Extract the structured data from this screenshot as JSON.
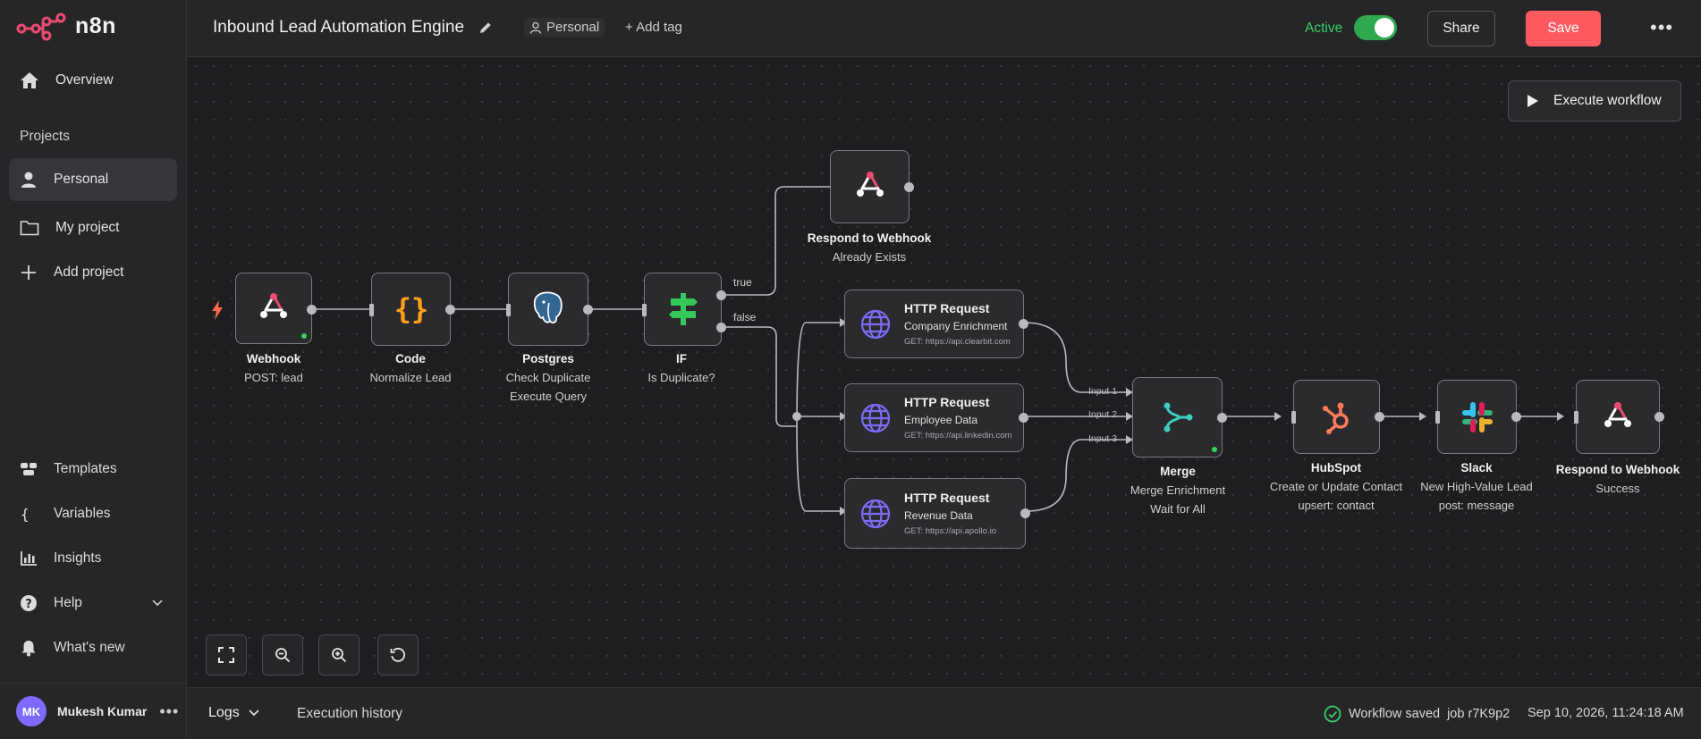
{
  "app": {
    "name": "n8n"
  },
  "sidebar": {
    "overview": "Overview",
    "projects_heading": "Projects",
    "projects": [
      {
        "label": "Personal",
        "icon": "user-icon",
        "active": true
      },
      {
        "label": "My project",
        "icon": "folder-icon",
        "active": false
      },
      {
        "label": "Add project",
        "icon": "plus-icon",
        "active": false
      }
    ],
    "bottom": [
      {
        "label": "Templates",
        "icon": "templates-icon"
      },
      {
        "label": "Variables",
        "icon": "braces-icon"
      },
      {
        "label": "Insights",
        "icon": "chart-icon"
      },
      {
        "label": "Help",
        "icon": "help-icon"
      },
      {
        "label": "What's new",
        "icon": "bell-icon"
      }
    ],
    "user": {
      "initials": "MK",
      "name": "Mukesh Kumar"
    }
  },
  "header": {
    "title": "Inbound Lead Automation Engine",
    "project_chip": "Personal",
    "add_tag": "+ Add tag",
    "active_label": "Active",
    "active": true,
    "share": "Share",
    "save": "Save"
  },
  "canvas": {
    "execute_button": "Execute workflow",
    "edge_labels": {
      "true": "true",
      "false": "false"
    },
    "merge_inputs": [
      "Input 1",
      "Input 2",
      "Input 3"
    ],
    "nodes": {
      "webhook": {
        "title": "Webhook",
        "sub": "POST: lead"
      },
      "code": {
        "title": "Code",
        "sub": "Normalize Lead"
      },
      "postgres": {
        "title": "Postgres",
        "sub1": "Check Duplicate",
        "sub2": "Execute Query"
      },
      "if": {
        "title": "IF",
        "sub": "Is Duplicate?"
      },
      "respond_exists": {
        "title": "Respond to Webhook",
        "sub": "Already Exists"
      },
      "http_company": {
        "title": "HTTP Request",
        "sub": "Company Enrichment",
        "url": "GET: https://api.clearbit.com"
      },
      "http_employee": {
        "title": "HTTP Request",
        "sub": "Employee Data",
        "url": "GET: https://api.linkedin.com"
      },
      "http_revenue": {
        "title": "HTTP Request",
        "sub": "Revenue Data",
        "url": "GET: https://api.apollo.io"
      },
      "merge": {
        "title": "Merge",
        "sub1": "Merge Enrichment",
        "sub2": "Wait for All"
      },
      "hubspot": {
        "title": "HubSpot",
        "sub1": "Create or Update Contact",
        "sub2": "upsert: contact"
      },
      "slack": {
        "title": "Slack",
        "sub1": "New High-Value Lead",
        "sub2": "post: message"
      },
      "respond_success": {
        "title": "Respond to Webhook",
        "sub": "Success"
      }
    },
    "controls": [
      "fit-view-icon",
      "zoom-out-icon",
      "zoom-in-icon",
      "reset-icon"
    ]
  },
  "footer": {
    "logs": "Logs",
    "execution_history": "Execution history",
    "saved_status": "Workflow saved",
    "job": "job r7K9p2",
    "timestamp": "Sep 10, 2026, 11:24:18 AM"
  },
  "colors": {
    "accent_red": "#ff5a5f",
    "active_green": "#38d167",
    "toggle_green": "#2fa84f",
    "avatar_purple": "#7d6bff"
  }
}
